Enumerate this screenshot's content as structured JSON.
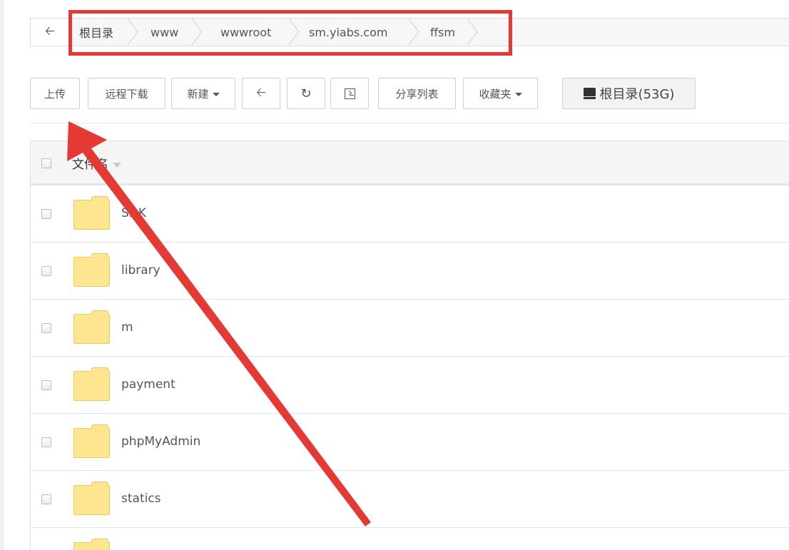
{
  "breadcrumb": {
    "items": [
      {
        "label": "根目录"
      },
      {
        "label": "www"
      },
      {
        "label": "wwwroot"
      },
      {
        "label": "sm.yiabs.com"
      },
      {
        "label": "ffsm"
      }
    ]
  },
  "toolbar": {
    "upload": "上传",
    "remote_download": "远程下载",
    "new": "新建",
    "share_list": "分享列表",
    "favorites": "收藏夹",
    "disk": "根目录(53G)"
  },
  "file_list": {
    "header": "文件名",
    "rows": [
      {
        "name": "SDK"
      },
      {
        "name": "library"
      },
      {
        "name": "m"
      },
      {
        "name": "payment"
      },
      {
        "name": "phpMyAdmin"
      },
      {
        "name": "statics"
      },
      {
        "name": ""
      }
    ]
  },
  "colors": {
    "annotation_red": "#e53935",
    "folder_yellow": "#fde68f"
  }
}
